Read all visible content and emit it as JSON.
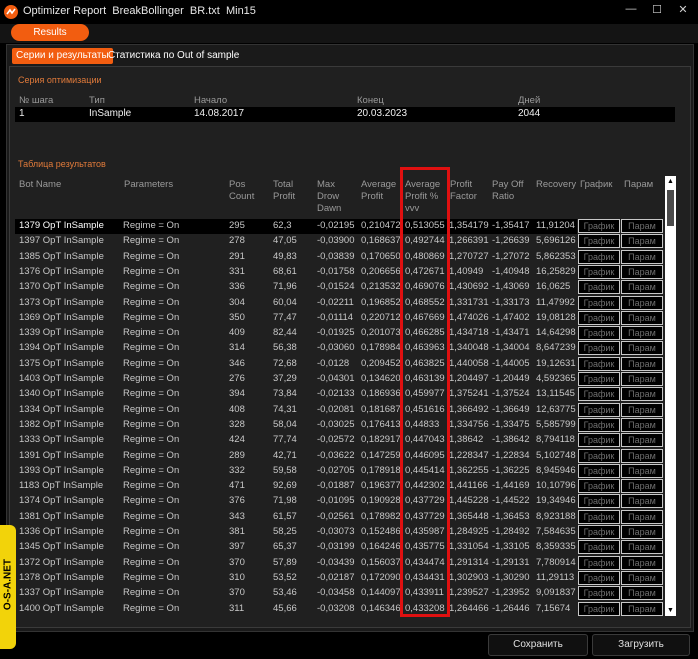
{
  "window": {
    "title": "Optimizer Report  BreakBollinger  BR.txt  Min15",
    "minimize": "—",
    "maximize": "☐",
    "close": "✕"
  },
  "top": {
    "results_label": "Results"
  },
  "tabs": [
    {
      "label": "Серии и результаты",
      "active": true
    },
    {
      "label": "Статистика по Out of sample",
      "active": false
    }
  ],
  "series": {
    "label": "Серия оптимизации",
    "headers": [
      "№ шага",
      "Тип",
      "Начало",
      "Конец",
      "Дней"
    ],
    "row": [
      "1",
      "InSample",
      "14.08.2017",
      "20.03.2023",
      "2044"
    ]
  },
  "results": {
    "label": "Таблица результатов",
    "headers": {
      "bot_name": "Bot Name",
      "parameters": "Parameters",
      "pos_count": "Pos\nCount",
      "total_profit": "Total\nProfit",
      "max_drawdown": "Max\nDrow\nDawn",
      "avg_profit": "Average\nProfit",
      "avg_profit_pct": "Average\nProfit %\nvvv",
      "profit_factor": "Profit\nFactor",
      "payoff_ratio": "Pay Off\nRatio",
      "recovery": "Recovery",
      "chart": "График",
      "params": "Парам"
    },
    "chart_button": "График",
    "params_button": "Парам",
    "rows": [
      [
        "1379 OpT InSample",
        "Regime = On",
        "295",
        "62,3",
        "-0,02195",
        "0,210472",
        "0,513055",
        "1,354179",
        "-1,35417",
        "11,91204"
      ],
      [
        "1397 OpT InSample",
        "Regime = On",
        "278",
        "47,05",
        "-0,03900",
        "0,168637",
        "0,492744",
        "1,266391",
        "-1,26639",
        "5,696126"
      ],
      [
        "1385 OpT InSample",
        "Regime = On",
        "291",
        "49,83",
        "-0,03839",
        "0,170650",
        "0,480869",
        "1,270727",
        "-1,27072",
        "5,862353"
      ],
      [
        "1376 OpT InSample",
        "Regime = On",
        "331",
        "68,61",
        "-0,01758",
        "0,206656",
        "0,472671",
        "1,40949",
        "-1,40948",
        "16,25829"
      ],
      [
        "1370 OpT InSample",
        "Regime = On",
        "336",
        "71,96",
        "-0,01524",
        "0,213532",
        "0,469076",
        "1,430692",
        "-1,43069",
        "16,0625"
      ],
      [
        "1373 OpT InSample",
        "Regime = On",
        "304",
        "60,04",
        "-0,02211",
        "0,196852",
        "0,468552",
        "1,331731",
        "-1,33173",
        "11,47992"
      ],
      [
        "1369 OpT InSample",
        "Regime = On",
        "350",
        "77,47",
        "-0,01114",
        "0,220712",
        "0,467669",
        "1,474026",
        "-1,47402",
        "19,08128"
      ],
      [
        "1339 OpT InSample",
        "Regime = On",
        "409",
        "82,44",
        "-0,01925",
        "0,201073",
        "0,466285",
        "1,434718",
        "-1,43471",
        "14,64298"
      ],
      [
        "1394 OpT InSample",
        "Regime = On",
        "314",
        "56,38",
        "-0,03060",
        "0,178984",
        "0,463963",
        "1,340048",
        "-1,34004",
        "8,647239"
      ],
      [
        "1375 OpT InSample",
        "Regime = On",
        "346",
        "72,68",
        "-0,0128",
        "0,209452",
        "0,463825",
        "1,440058",
        "-1,44005",
        "19,12631"
      ],
      [
        "1403 OpT InSample",
        "Regime = On",
        "276",
        "37,29",
        "-0,04301",
        "0,134620",
        "0,463139",
        "1,204497",
        "-1,20449",
        "4,592365"
      ],
      [
        "1340 OpT InSample",
        "Regime = On",
        "394",
        "73,84",
        "-0,02133",
        "0,186936",
        "0,459977",
        "1,375241",
        "-1,37524",
        "13,11545"
      ],
      [
        "1334 OpT InSample",
        "Regime = On",
        "408",
        "74,31",
        "-0,02081",
        "0,181687",
        "0,451616",
        "1,366492",
        "-1,36649",
        "12,63775"
      ],
      [
        "1382 OpT InSample",
        "Regime = On",
        "328",
        "58,04",
        "-0,03025",
        "0,176413",
        "0,44833",
        "1,334756",
        "-1,33475",
        "5,585799"
      ],
      [
        "1333 OpT InSample",
        "Regime = On",
        "424",
        "77,74",
        "-0,02572",
        "0,182917",
        "0,447043",
        "1,38642",
        "-1,38642",
        "8,794118"
      ],
      [
        "1391 OpT InSample",
        "Regime = On",
        "289",
        "42,71",
        "-0,03622",
        "0,147259",
        "0,446095",
        "1,228347",
        "-1,22834",
        "5,102748"
      ],
      [
        "1393 OpT InSample",
        "Regime = On",
        "332",
        "59,58",
        "-0,02705",
        "0,178918",
        "0,445414",
        "1,362255",
        "-1,36225",
        "8,945946"
      ],
      [
        "1183 OpT InSample",
        "Regime = On",
        "471",
        "92,69",
        "-0,01887",
        "0,196377",
        "0,442302",
        "1,441166",
        "-1,44169",
        "10,10796"
      ],
      [
        "1374 OpT InSample",
        "Regime = On",
        "376",
        "71,98",
        "-0,01095",
        "0,190928",
        "0,437729",
        "1,445228",
        "-1,44522",
        "19,34946"
      ],
      [
        "1381 OpT InSample",
        "Regime = On",
        "343",
        "61,57",
        "-0,02561",
        "0,178982",
        "0,437729",
        "1,365448",
        "-1,36453",
        "8,923188"
      ],
      [
        "1336 OpT InSample",
        "Regime = On",
        "381",
        "58,25",
        "-0,03073",
        "0,152486",
        "0,435987",
        "1,284925",
        "-1,28492",
        "7,584635"
      ],
      [
        "1345 OpT InSample",
        "Regime = On",
        "397",
        "65,37",
        "-0,03199",
        "0,164246",
        "0,435775",
        "1,331054",
        "-1,33105",
        "8,359335"
      ],
      [
        "1372 OpT InSample",
        "Regime = On",
        "370",
        "57,89",
        "-0,03439",
        "0,156037",
        "0,434474",
        "1,291314",
        "-1,29131",
        "7,780914"
      ],
      [
        "1378 OpT InSample",
        "Regime = On",
        "310",
        "53,52",
        "-0,02187",
        "0,172090",
        "0,434431",
        "1,302903",
        "-1,30290",
        "11,29113"
      ],
      [
        "1337 OpT InSample",
        "Regime = On",
        "370",
        "53,46",
        "-0,03458",
        "0,144097",
        "0,433911",
        "1,239527",
        "-1,23952",
        "9,091837"
      ],
      [
        "1400 OpT InSample",
        "Regime = On",
        "311",
        "45,66",
        "-0,03208",
        "0,146346",
        "0,433208",
        "1,264466",
        "-1,26446",
        "7,15674"
      ]
    ]
  },
  "footer": {
    "save": "Сохранить",
    "load": "Загрузить"
  },
  "badge": {
    "text": "O-S-A.NET"
  },
  "colors": {
    "accent": "#f25d10",
    "highlight": "#e01010",
    "section_label": "#e07a3a",
    "badge": "#f2d30a"
  }
}
